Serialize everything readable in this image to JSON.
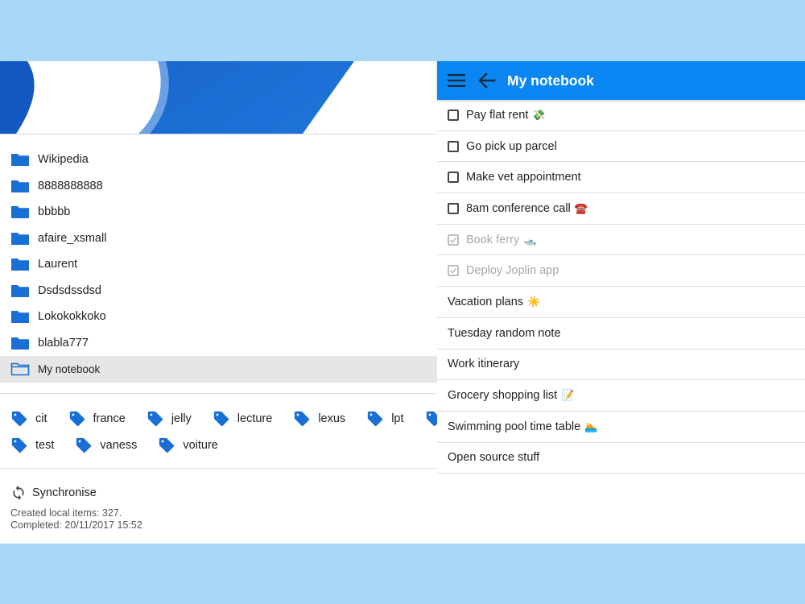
{
  "drawer": {
    "folders": [
      {
        "label": "Wikipedia"
      },
      {
        "label": "8888888888"
      },
      {
        "label": "bbbbb"
      },
      {
        "label": "afaire_xsmall"
      },
      {
        "label": "Laurent"
      },
      {
        "label": "Dsdsdssdsd"
      },
      {
        "label": "Lokokokkoko"
      },
      {
        "label": "blabla777"
      },
      {
        "label": "My notebook"
      }
    ],
    "tags_row1": [
      "cit",
      "france",
      "jelly",
      "lecture",
      "lexus",
      "lpt"
    ],
    "tags_row2": [
      "test",
      "vaness",
      "voiture"
    ],
    "sync": {
      "label": "Synchronise",
      "created": "Created local items: 327.",
      "completed": "Completed: 20/11/2017 15:52"
    }
  },
  "topbar": {
    "title": "My notebook"
  },
  "notes": [
    {
      "title": "Pay flat rent",
      "emoji": "💸",
      "todo": true,
      "completed": false
    },
    {
      "title": "Go pick up parcel",
      "emoji": "",
      "todo": true,
      "completed": false
    },
    {
      "title": "Make vet appointment",
      "emoji": "",
      "todo": true,
      "completed": false
    },
    {
      "title": "8am conference call",
      "emoji": "☎️",
      "todo": true,
      "completed": false
    },
    {
      "title": "Book ferry",
      "emoji": "🛥️",
      "todo": true,
      "completed": true
    },
    {
      "title": "Deploy Joplin app",
      "emoji": "",
      "todo": true,
      "completed": true
    },
    {
      "title": "Vacation plans",
      "emoji": "☀️",
      "todo": false,
      "completed": false
    },
    {
      "title": "Tuesday random note",
      "emoji": "",
      "todo": false,
      "completed": false
    },
    {
      "title": "Work itinerary",
      "emoji": "",
      "todo": false,
      "completed": false
    },
    {
      "title": "Grocery shopping list",
      "emoji": "📝",
      "todo": false,
      "completed": false
    },
    {
      "title": "Swimming pool time table",
      "emoji": "🏊",
      "todo": false,
      "completed": false
    },
    {
      "title": "Open source stuff",
      "emoji": "",
      "todo": false,
      "completed": false
    }
  ],
  "colors": {
    "accent": "#0a86f2",
    "folder_icon": "#1a6fd4",
    "page_background": "#a8d8f5",
    "completed_text": "#a7a7a7"
  },
  "icons": {
    "folder": "folder-icon",
    "folder_open": "folder-open-icon",
    "tag": "tag-icon",
    "sync": "sync-icon",
    "menu": "hamburger-menu-icon",
    "back": "back-arrow-icon",
    "checkbox": "checkbox-icon"
  }
}
